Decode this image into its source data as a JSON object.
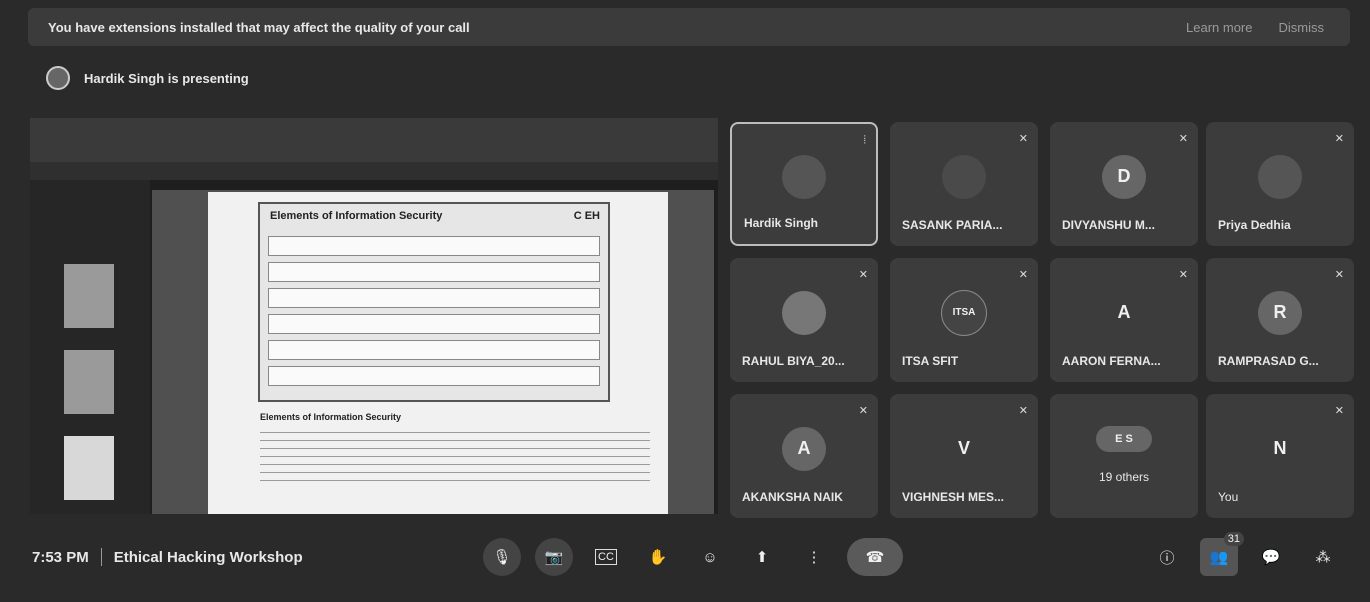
{
  "banner": {
    "message": "You have extensions installed that may affect the quality of your call",
    "learn_more": "Learn more",
    "dismiss": "Dismiss"
  },
  "presenter": {
    "text": "Hardik Singh is presenting"
  },
  "slide": {
    "title": "Elements of Information Security",
    "badge": "C EH",
    "section": "Elements of Information Security"
  },
  "participants": [
    {
      "name": "Hardik Singh",
      "avatar": "",
      "muted": false
    },
    {
      "name": "SASANK PARIA...",
      "avatar": "",
      "muted": true
    },
    {
      "name": "DIVYANSHU M...",
      "avatar": "D",
      "muted": true
    },
    {
      "name": "Priya Dedhia",
      "avatar": "",
      "muted": true
    },
    {
      "name": "RAHUL BIYA_20...",
      "avatar": "",
      "muted": true
    },
    {
      "name": "ITSA SFIT",
      "avatar": "ITSA",
      "muted": true
    },
    {
      "name": "AARON FERNA...",
      "avatar": "A",
      "muted": true
    },
    {
      "name": "RAMPRASAD G...",
      "avatar": "R",
      "muted": true
    },
    {
      "name": "AKANKSHA NAIK",
      "avatar": "A",
      "muted": true
    },
    {
      "name": "VIGHNESH MES...",
      "avatar": "V",
      "muted": true
    },
    {
      "name": "19 others",
      "avatar": "E S",
      "muted": false
    },
    {
      "name": "You",
      "avatar": "N",
      "muted": true
    }
  ],
  "meeting": {
    "time": "7:53 PM",
    "title": "Ethical Hacking Workshop"
  },
  "people_count": "31",
  "icons": {
    "mic_off": "🎙",
    "cam_off": "📷",
    "captions": "CC",
    "hand": "✋",
    "emoji": "☺",
    "present": "⬆",
    "more": "⋮",
    "end": "☎",
    "info": "ⓘ",
    "people": "👥",
    "chat": "💬",
    "activities": "⁂"
  }
}
